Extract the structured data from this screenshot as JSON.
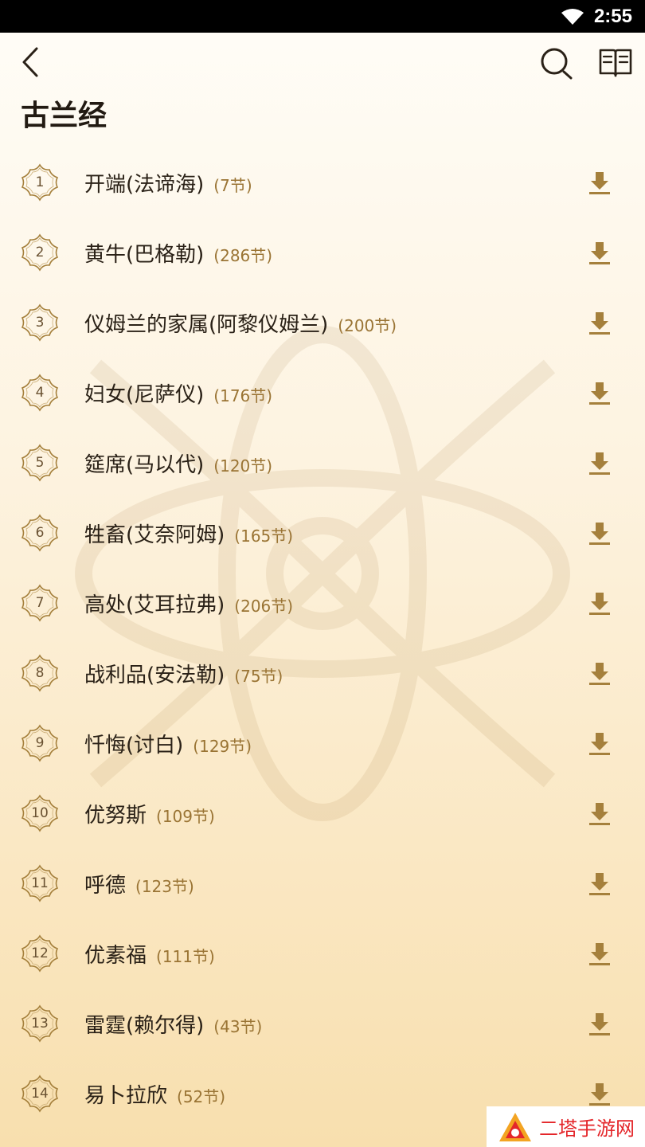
{
  "status_bar": {
    "time": "2:55"
  },
  "header": {
    "title": "古兰经"
  },
  "chapters": [
    {
      "num": "1",
      "name": "开端(法谛海)",
      "count": "(7节)"
    },
    {
      "num": "2",
      "name": "黄牛(巴格勒)",
      "count": "(286节)"
    },
    {
      "num": "3",
      "name": "仪姆兰的家属(阿黎仪姆兰)",
      "count": "(200节)"
    },
    {
      "num": "4",
      "name": "妇女(尼萨仪)",
      "count": "(176节)"
    },
    {
      "num": "5",
      "name": "筵席(马以代)",
      "count": "(120节)"
    },
    {
      "num": "6",
      "name": "牲畜(艾奈阿姆)",
      "count": "(165节)"
    },
    {
      "num": "7",
      "name": "高处(艾耳拉弗)",
      "count": "(206节)"
    },
    {
      "num": "8",
      "name": "战利品(安法勒)",
      "count": "(75节)"
    },
    {
      "num": "9",
      "name": "忏悔(讨白)",
      "count": "(129节)"
    },
    {
      "num": "10",
      "name": "优努斯",
      "count": "(109节)"
    },
    {
      "num": "11",
      "name": "呼德",
      "count": "(123节)"
    },
    {
      "num": "12",
      "name": "优素福",
      "count": "(111节)"
    },
    {
      "num": "13",
      "name": "雷霆(赖尔得)",
      "count": "(43节)"
    },
    {
      "num": "14",
      "name": "易卜拉欣",
      "count": "(52节)"
    }
  ],
  "watermark": {
    "text": "二塔手游网"
  },
  "colors": {
    "accent": "#9a7434",
    "icon": "#a5803c"
  }
}
